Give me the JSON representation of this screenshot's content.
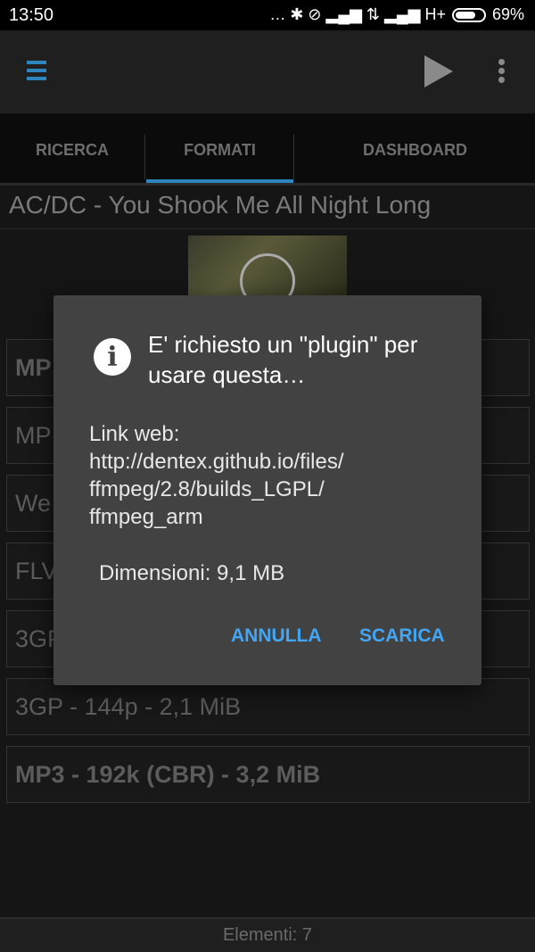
{
  "status_bar": {
    "time": "13:50",
    "indicators": "… ✱ ⊘ ▂▄▆ ⇅ ▂▄▆ H+",
    "battery": "69%"
  },
  "app_bar": {
    "menu_icon": "hamburger-menu-icon",
    "play_icon": "play-icon",
    "more_icon": "more-vert-icon",
    "accent_color": "#2e86c1"
  },
  "tabs": [
    {
      "label": "RICERCA"
    },
    {
      "label": "FORMATI"
    },
    {
      "label": "DASHBOARD"
    }
  ],
  "video": {
    "title": "AC/DC - You Shook Me All Night Long"
  },
  "formats": [
    {
      "label": "MP",
      "bold": true
    },
    {
      "label": "MP",
      "bold": false
    },
    {
      "label": "We",
      "bold": false
    },
    {
      "label": "FLV",
      "bold": false
    },
    {
      "label": "3GP",
      "bold": false
    },
    {
      "label": "3GP - 144p - 2,1 MiB",
      "bold": false
    },
    {
      "label": "MP3 - 192k (CBR) - 3,2 MiB",
      "bold": true
    }
  ],
  "footer": {
    "count_text": "Elementi: 7"
  },
  "dialog": {
    "title": "E' richiesto un \"plugin\" per usare questa…",
    "body_line1": "Link web:",
    "body_line2": "http://dentex.github.io/files/",
    "body_line3": "ffmpeg/2.8/builds_LGPL/",
    "body_line4": "ffmpeg_arm",
    "size": "Dimensioni: 9,1 MB",
    "cancel_label": "ANNULLA",
    "confirm_label": "SCARICA",
    "button_color": "#42a5f5"
  }
}
